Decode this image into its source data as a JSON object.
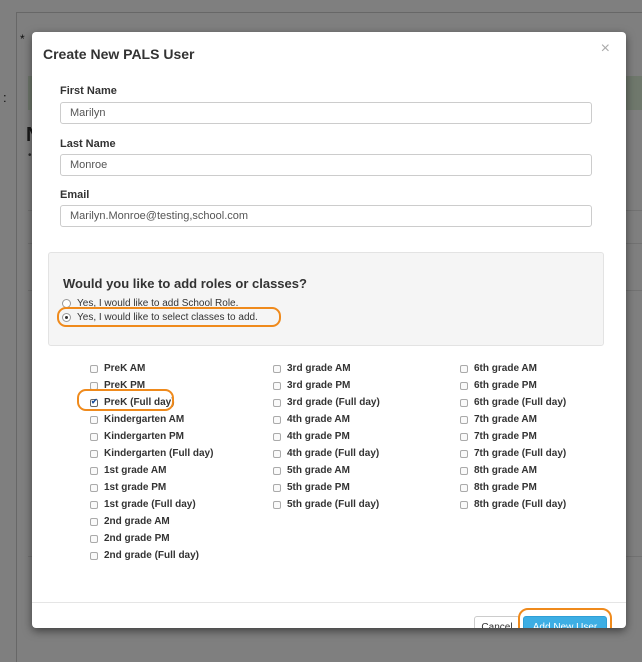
{
  "background": {
    "star": "*",
    "colon": ":",
    "heading_fragment": "N",
    "bullet": "•"
  },
  "modal": {
    "title": "Create New PALS User",
    "close_glyph": "×"
  },
  "form": {
    "first_name": {
      "label": "First Name",
      "value": "Marilyn"
    },
    "last_name": {
      "label": "Last Name",
      "value": "Monroe"
    },
    "email": {
      "label": "Email",
      "value": "Marilyn.Monroe@testing,school.com"
    }
  },
  "roles": {
    "heading": "Would you like to add roles or classes?",
    "options": [
      {
        "label": "Yes, I would like to add School Role.",
        "selected": false
      },
      {
        "label": "Yes, I would like to select classes to add.",
        "selected": true
      }
    ]
  },
  "classes": {
    "col1": [
      {
        "label": "PreK AM",
        "checked": false
      },
      {
        "label": "PreK PM",
        "checked": false
      },
      {
        "label": "PreK (Full day)",
        "checked": true
      },
      {
        "label": "Kindergarten AM",
        "checked": false
      },
      {
        "label": "Kindergarten PM",
        "checked": false
      },
      {
        "label": "Kindergarten (Full day)",
        "checked": false
      },
      {
        "label": "1st grade AM",
        "checked": false
      },
      {
        "label": "1st grade PM",
        "checked": false
      },
      {
        "label": "1st grade (Full day)",
        "checked": false
      },
      {
        "label": "2nd grade AM",
        "checked": false
      },
      {
        "label": "2nd grade PM",
        "checked": false
      },
      {
        "label": "2nd grade (Full day)",
        "checked": false
      }
    ],
    "col2": [
      {
        "label": "3rd grade AM",
        "checked": false
      },
      {
        "label": "3rd grade PM",
        "checked": false
      },
      {
        "label": "3rd grade (Full day)",
        "checked": false
      },
      {
        "label": "4th grade AM",
        "checked": false
      },
      {
        "label": "4th grade PM",
        "checked": false
      },
      {
        "label": "4th grade (Full day)",
        "checked": false
      },
      {
        "label": "5th grade AM",
        "checked": false
      },
      {
        "label": "5th grade PM",
        "checked": false
      },
      {
        "label": "5th grade (Full day)",
        "checked": false
      }
    ],
    "col3": [
      {
        "label": "6th grade AM",
        "checked": false
      },
      {
        "label": "6th grade PM",
        "checked": false
      },
      {
        "label": "6th grade (Full day)",
        "checked": false
      },
      {
        "label": "7th grade AM",
        "checked": false
      },
      {
        "label": "7th grade PM",
        "checked": false
      },
      {
        "label": "7th grade (Full day)",
        "checked": false
      },
      {
        "label": "8th grade AM",
        "checked": false
      },
      {
        "label": "8th grade PM",
        "checked": false
      },
      {
        "label": "8th grade (Full day)",
        "checked": false
      }
    ]
  },
  "footer": {
    "cancel_label": "Cancel",
    "submit_label": "Add New User"
  },
  "colors": {
    "highlight": "#ef8a1c",
    "primary_button": "#3daee4",
    "success_banner": "#dff0d8"
  }
}
